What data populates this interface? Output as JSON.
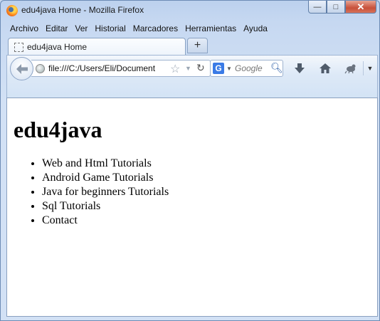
{
  "window": {
    "title": "edu4java Home - Mozilla Firefox",
    "caption_buttons": {
      "minimize": "—",
      "maximize": "□",
      "close": "✕"
    }
  },
  "menubar": {
    "items": [
      "Archivo",
      "Editar",
      "Ver",
      "Historial",
      "Marcadores",
      "Herramientas",
      "Ayuda"
    ]
  },
  "tabs": [
    {
      "label": "edu4java Home",
      "icon": "blank-page-icon"
    }
  ],
  "newtab_label": "+",
  "navbar": {
    "url": "file:///C:/Users/Eli/Document",
    "search_engine": "G",
    "search_placeholder": "Google",
    "icons": [
      "back-arrow-icon",
      "globe-icon",
      "bookmark-star-icon",
      "dropdown-icon",
      "reload-icon",
      "search-icon",
      "download-icon",
      "home-icon",
      "addon-icon",
      "menu-dropdown-icon"
    ]
  },
  "page": {
    "heading": "edu4java",
    "links": [
      "Web and Html Tutorials",
      "Android Game Tutorials",
      "Java for beginners Tutorials",
      "Sql Tutorials",
      "Contact"
    ]
  },
  "colors": {
    "chrome": "#c6d8f1",
    "close_button": "#c7503a",
    "accent": "#3b7be6"
  }
}
